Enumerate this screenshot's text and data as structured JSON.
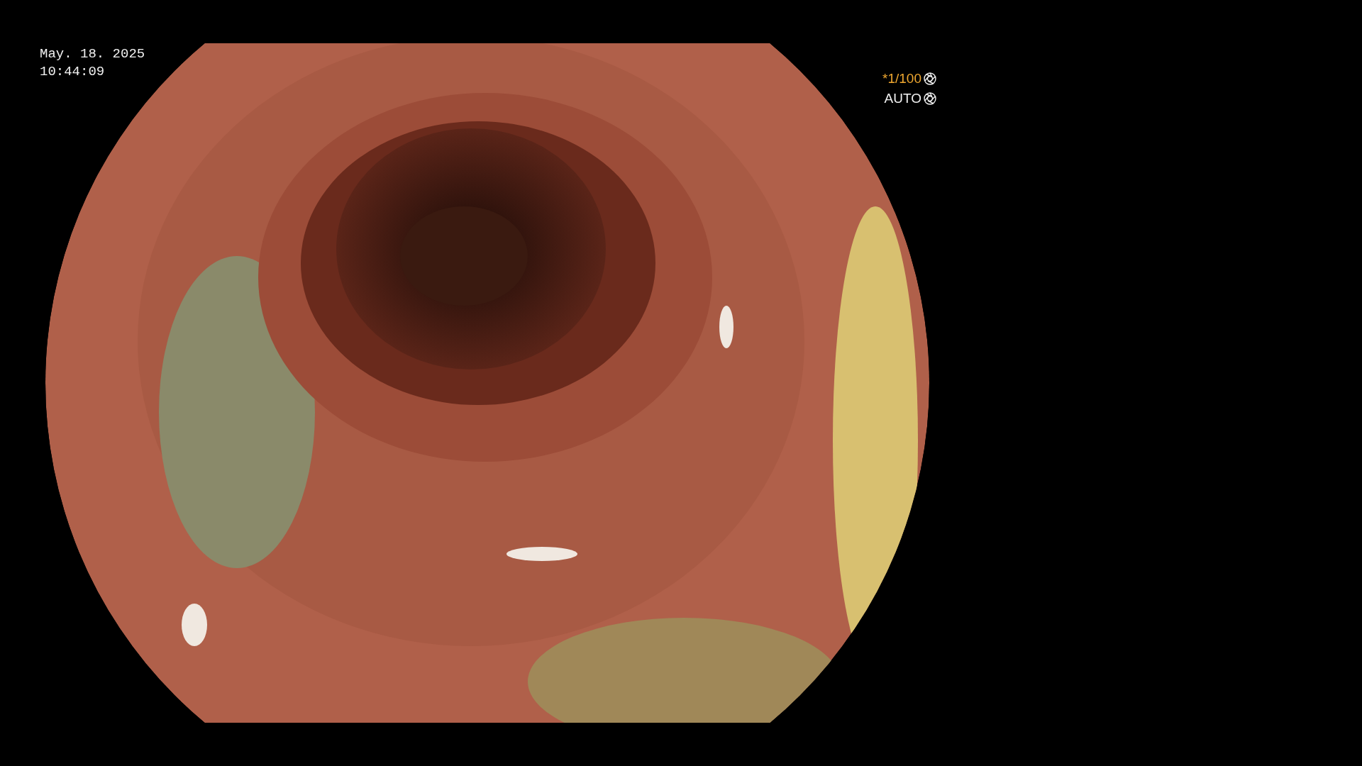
{
  "clock": {
    "date": "May. 18. 2025",
    "time": "10:44:09"
  },
  "exposure": {
    "shutter": "*1/100",
    "mode": "AUTO"
  }
}
